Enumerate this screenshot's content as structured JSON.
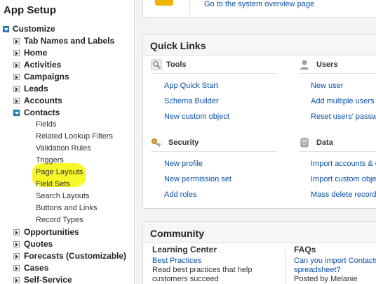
{
  "sidebar": {
    "title": "App Setup",
    "items": [
      {
        "label": "Customize",
        "level": 0,
        "toggle": "open",
        "name": "sidebar-item-customize"
      },
      {
        "label": "Tab Names and Labels",
        "level": 1,
        "toggle": "closed",
        "name": "sidebar-item-tab-names-and-labels"
      },
      {
        "label": "Home",
        "level": 1,
        "toggle": "closed",
        "name": "sidebar-item-home"
      },
      {
        "label": "Activities",
        "level": 1,
        "toggle": "closed",
        "name": "sidebar-item-activities"
      },
      {
        "label": "Campaigns",
        "level": 1,
        "toggle": "closed",
        "name": "sidebar-item-campaigns"
      },
      {
        "label": "Leads",
        "level": 1,
        "toggle": "closed",
        "name": "sidebar-item-leads"
      },
      {
        "label": "Accounts",
        "level": 1,
        "toggle": "closed",
        "name": "sidebar-item-accounts"
      },
      {
        "label": "Contacts",
        "level": 1,
        "toggle": "open",
        "name": "sidebar-item-contacts"
      },
      {
        "label": "Fields",
        "level": 2,
        "name": "sidebar-item-fields"
      },
      {
        "label": "Related Lookup Filters",
        "level": 2,
        "name": "sidebar-item-related-lookup-filters"
      },
      {
        "label": "Validation Rules",
        "level": 2,
        "name": "sidebar-item-validation-rules"
      },
      {
        "label": "Triggers",
        "level": 2,
        "name": "sidebar-item-triggers"
      },
      {
        "label": "Page Layouts",
        "level": 2,
        "name": "sidebar-item-page-layouts"
      },
      {
        "label": "Field Sets",
        "level": 2,
        "name": "sidebar-item-field-sets"
      },
      {
        "label": "Search Layouts",
        "level": 2,
        "name": "sidebar-item-search-layouts"
      },
      {
        "label": "Buttons and Links",
        "level": 2,
        "name": "sidebar-item-buttons-and-links"
      },
      {
        "label": "Record Types",
        "level": 2,
        "name": "sidebar-item-record-types"
      },
      {
        "label": "Opportunities",
        "level": 1,
        "toggle": "closed",
        "name": "sidebar-item-opportunities"
      },
      {
        "label": "Quotes",
        "level": 1,
        "toggle": "closed",
        "name": "sidebar-item-quotes"
      },
      {
        "label": "Forecasts (Customizable)",
        "level": 1,
        "toggle": "closed",
        "name": "sidebar-item-forecasts"
      },
      {
        "label": "Cases",
        "level": 1,
        "toggle": "closed",
        "name": "sidebar-item-cases"
      },
      {
        "label": "Self-Service",
        "level": 1,
        "toggle": "closed",
        "name": "sidebar-item-self-service"
      }
    ],
    "highlight_color": "#f8f72a"
  },
  "overview": {
    "link": "Go to the system overview page"
  },
  "quick_links": {
    "title": "Quick Links",
    "tools": {
      "heading": "Tools",
      "icon": "magnifier-icon",
      "links": [
        "App Quick Start",
        "Schema Builder",
        "New custom object"
      ]
    },
    "users": {
      "heading": "Users",
      "icon": "user-silhouette-icon",
      "links": [
        "New user",
        "Add multiple users",
        "Reset users' passw"
      ]
    },
    "security": {
      "heading": "Security",
      "icon": "key-icon",
      "links": [
        "New profile",
        "New permission set",
        "Add roles"
      ]
    },
    "data": {
      "heading": "Data",
      "icon": "database-icon",
      "links": [
        "Import accounts & c",
        "Import custom objec",
        "Mass delete record"
      ]
    }
  },
  "community": {
    "title": "Community",
    "learning": {
      "heading": "Learning Center",
      "link": "Best Practices",
      "text_1": "Read best practices that help",
      "text_2": "customers succeed"
    },
    "faqs": {
      "heading": "FAQs",
      "link_1": "Can you import Contacts",
      "link_2": "spreadsheet?",
      "posted": "Posted by Melanie Willian"
    }
  },
  "colors": {
    "link": "#0b4fa3",
    "toggle_open": "#2a86c2",
    "panel_bg": "#f3f3f3"
  }
}
